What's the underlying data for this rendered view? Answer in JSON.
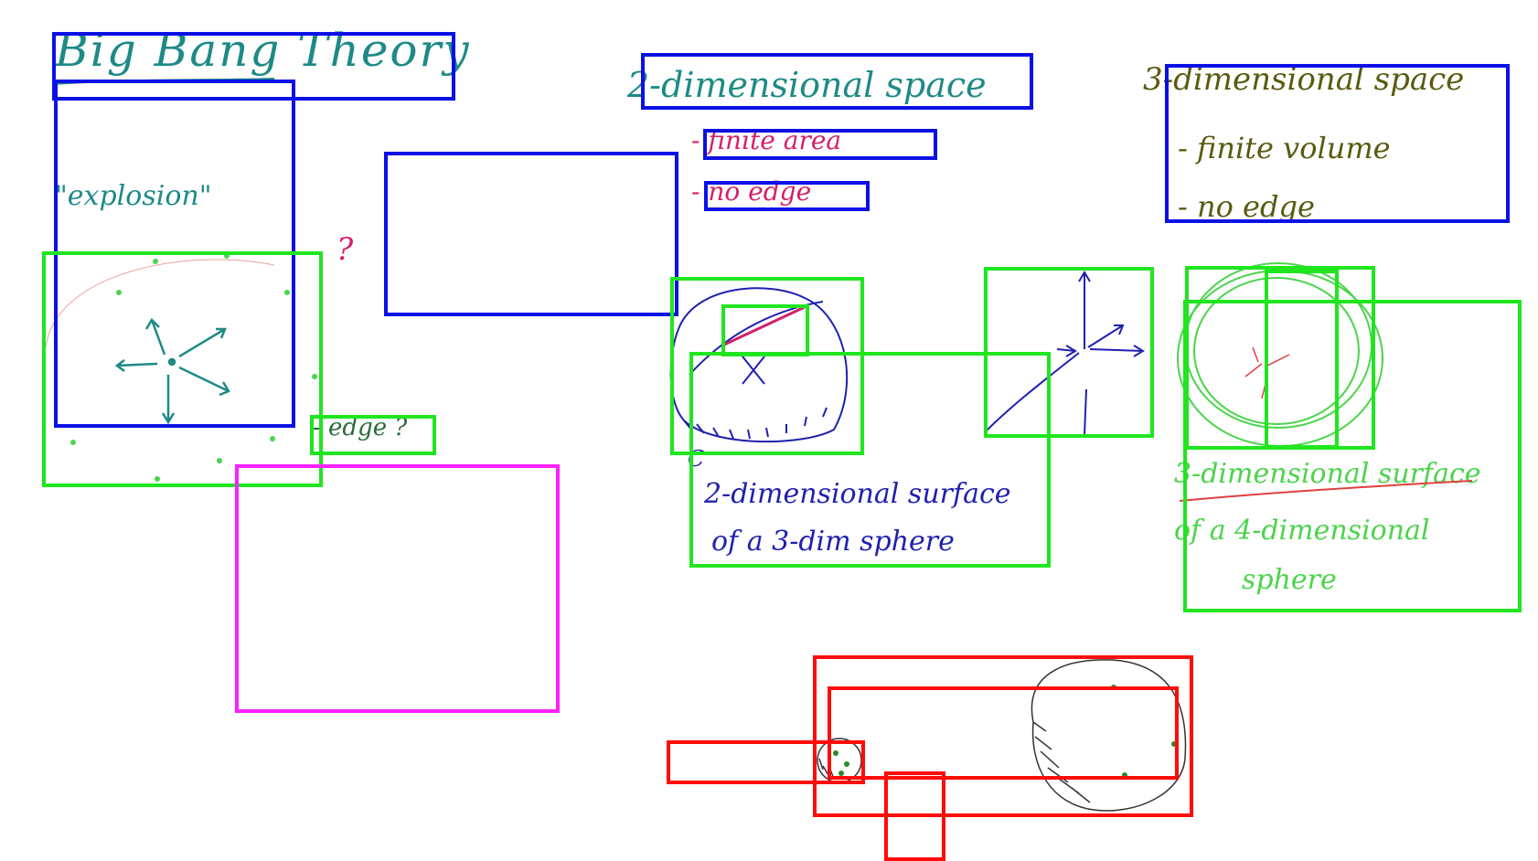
{
  "colors": {
    "blue_box": "#0b10e6",
    "green_box": "#1fe61f",
    "magenta_box": "#ff1fff",
    "red_box": "#ff0b0b",
    "teal_ink": "#1e8a86",
    "navy_ink": "#2020b0",
    "pink_ink": "#d4206a",
    "olive_ink": "#5b5a10",
    "green_ink": "#4bd44b",
    "dot_green": "#2a8a2a",
    "sketch_gray": "#333333"
  },
  "title": "Big Bang Theory",
  "explosion_label": "\"explosion\"",
  "question_mark": "?",
  "edge_label": "- edge ?",
  "space_2d": {
    "heading": "2-dimensional space",
    "item_1": "- finite area",
    "item_2": "- no edge"
  },
  "space_3d": {
    "heading": "3-dimensional space",
    "item_1": "- finite volume",
    "item_2": "- no edge"
  },
  "surface_2d": {
    "mark": "C",
    "line_1": "2-dimensional surface",
    "line_2": "of a 3-dim sphere"
  },
  "surface_3d": {
    "line_1": "3-dimensional surface",
    "line_2": "of a 4-dimensional",
    "line_3": "sphere"
  },
  "icons": [
    "explosion-arrows-icon",
    "sphere-sketch-icon",
    "axes-icon",
    "nested-spheres-icon",
    "small-sphere-icon",
    "large-sphere-icon"
  ]
}
